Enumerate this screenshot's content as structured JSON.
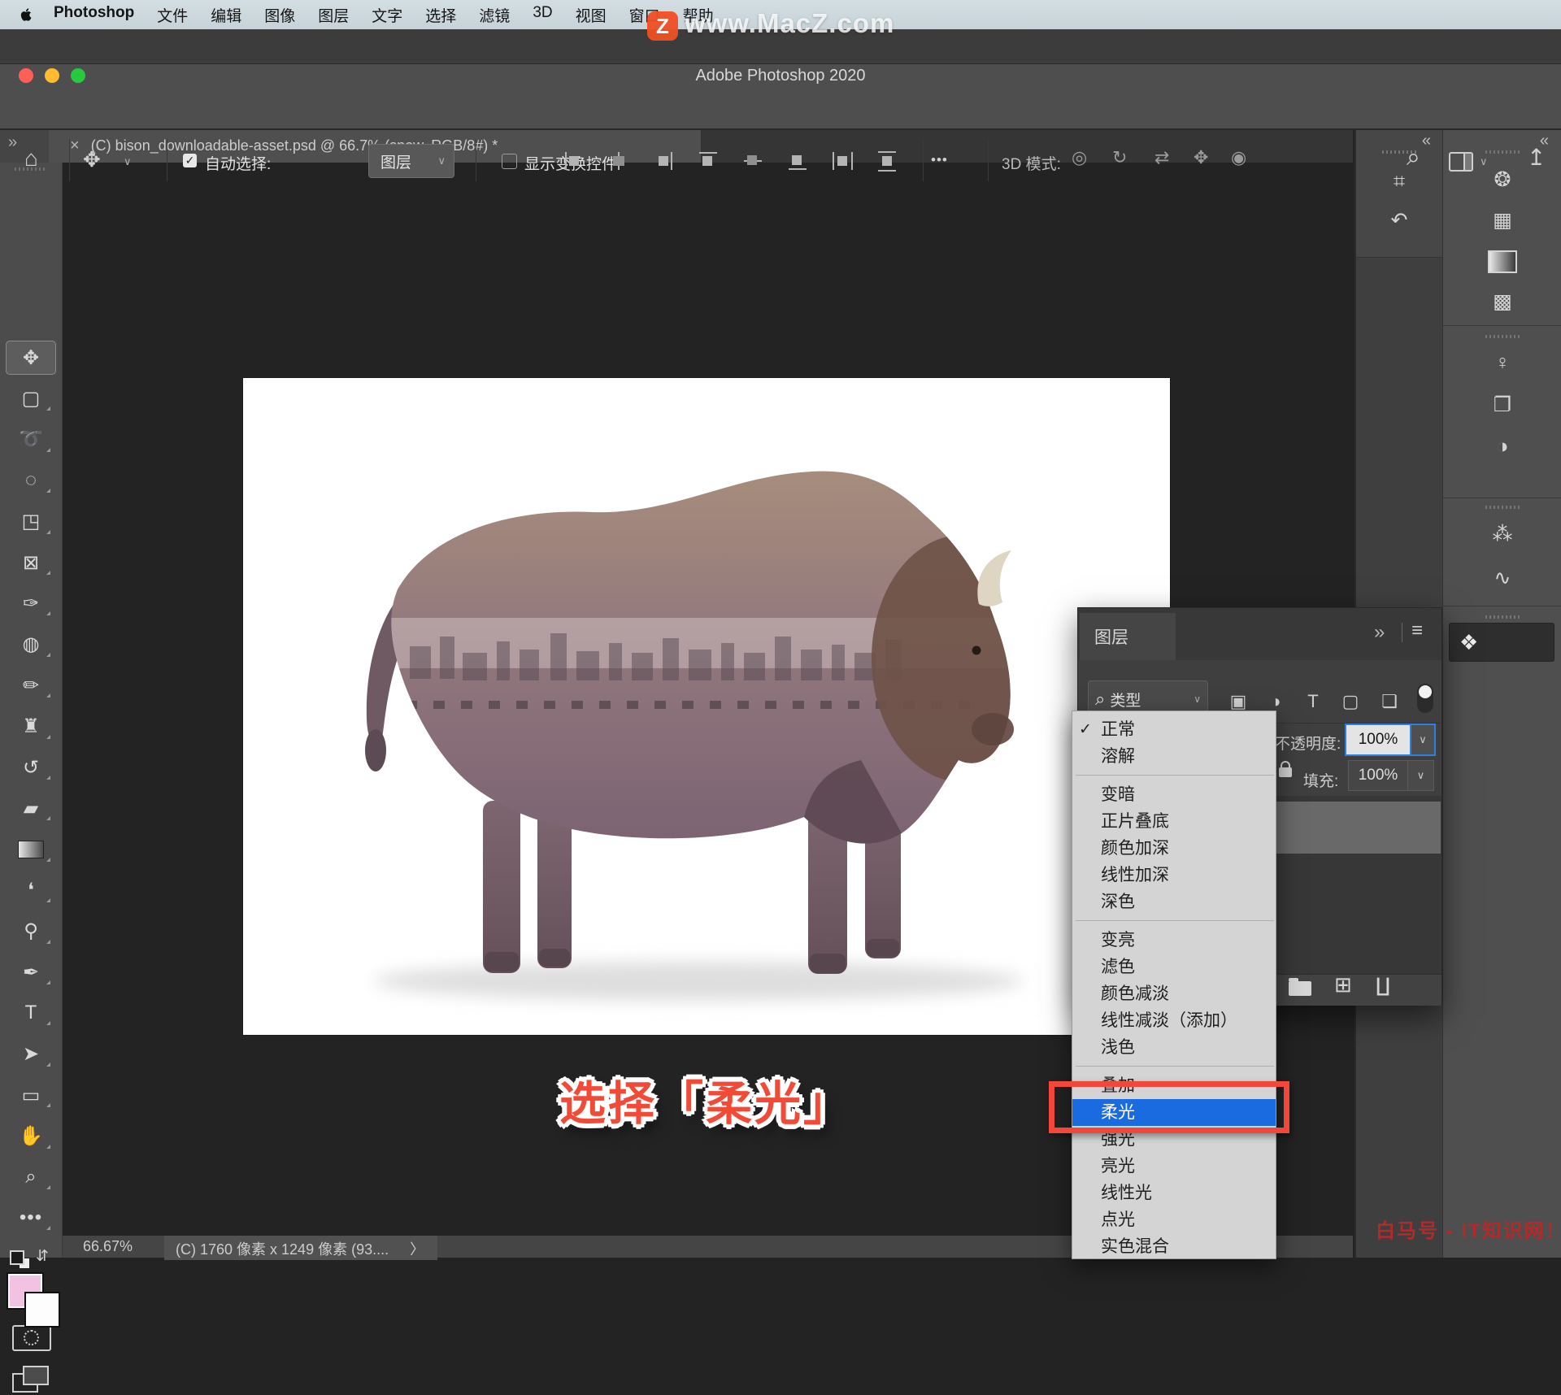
{
  "colors": {
    "accent_blue": "#1a6be0",
    "annotation_red": "#f14b38",
    "badge_orange": "#f04f23",
    "fg_swatch_pink": "#f2c2e2",
    "watermark_red": "#b22a2a"
  },
  "menubar": {
    "apple_icon": "apple-logo",
    "items": [
      "Photoshop",
      "文件",
      "编辑",
      "图像",
      "图层",
      "文字",
      "选择",
      "滤镜",
      "3D",
      "视图",
      "窗口",
      "帮助"
    ]
  },
  "titlebar": {
    "title": "Adobe Photoshop 2020"
  },
  "watermark_top": {
    "badge": "Z",
    "text": "www.MacZ.com"
  },
  "watermark_bottom": {
    "text": "白马号 - IT知识网！"
  },
  "options_bar": {
    "home_icon": "⌂",
    "move_icon": "✥",
    "chevron": "∨",
    "auto_select_label": "自动选择:",
    "target_value": "图层",
    "show_transform_label": "显示变换控件",
    "align_icons": [
      {
        "name": "align-left-icon"
      },
      {
        "name": "align-center-h-icon"
      },
      {
        "name": "align-right-icon"
      },
      {
        "name": "align-top-icon"
      },
      {
        "name": "align-middle-icon"
      },
      {
        "name": "align-bottom-icon"
      },
      {
        "name": "distribute-h-icon"
      },
      {
        "name": "distribute-v-icon"
      }
    ],
    "more_label": "•••",
    "mode_3d_label": "3D 模式:",
    "mode_3d_icons": [
      {
        "name": "3d-orbit-icon",
        "glyph": "◎"
      },
      {
        "name": "3d-roll-icon",
        "glyph": "↻"
      },
      {
        "name": "3d-pan-icon",
        "glyph": "⇄"
      },
      {
        "name": "3d-slide-icon",
        "glyph": "✥"
      },
      {
        "name": "3d-camera-icon",
        "glyph": "◉"
      }
    ],
    "search_icon": "⌕",
    "share_icon": "↥"
  },
  "tab_bar": {
    "collapse_icon": "»",
    "close_icon": "×",
    "title": "(C) bison_downloadable-asset.psd @ 66.7% (snow, RGB/8#) *"
  },
  "toolbar": {
    "tools": [
      {
        "name": "move-tool",
        "glyph": "✥",
        "selected": true
      },
      {
        "name": "marquee-tool",
        "glyph": "▢"
      },
      {
        "name": "lasso-tool",
        "glyph": "➰"
      },
      {
        "name": "object-selection-tool",
        "glyph": "◌"
      },
      {
        "name": "crop-tool",
        "glyph": "◳"
      },
      {
        "name": "frame-tool",
        "glyph": "⊠"
      },
      {
        "name": "eyedropper-tool",
        "glyph": "✑"
      },
      {
        "name": "healing-brush-tool",
        "glyph": "◍"
      },
      {
        "name": "brush-tool",
        "glyph": "✏"
      },
      {
        "name": "clone-stamp-tool",
        "glyph": "♜"
      },
      {
        "name": "history-brush-tool",
        "glyph": "↺"
      },
      {
        "name": "eraser-tool",
        "glyph": "▰"
      },
      {
        "name": "gradient-tool",
        "glyph": ""
      },
      {
        "name": "blur-tool",
        "glyph": "❛"
      },
      {
        "name": "dodge-tool",
        "glyph": "⚲"
      },
      {
        "name": "pen-tool",
        "glyph": "✒"
      },
      {
        "name": "type-tool",
        "glyph": "T"
      },
      {
        "name": "path-select-tool",
        "glyph": "➤"
      },
      {
        "name": "shape-tool",
        "glyph": "▭"
      },
      {
        "name": "hand-tool",
        "glyph": "✋"
      },
      {
        "name": "zoom-tool",
        "glyph": "⌕"
      },
      {
        "name": "toolbar-more",
        "glyph": "•••"
      }
    ]
  },
  "layers_panel": {
    "tab_label": "图层",
    "collapse_icon": "»",
    "menu_icon": "≡",
    "filter": {
      "search_icon": "⌕",
      "label": "类型",
      "chevron": "∨",
      "icons": [
        {
          "name": "filter-image-icon",
          "glyph": "▣"
        },
        {
          "name": "filter-adjustment-icon",
          "glyph": "◑"
        },
        {
          "name": "filter-type-icon",
          "glyph": "T"
        },
        {
          "name": "filter-shape-icon",
          "glyph": "▢"
        },
        {
          "name": "filter-smart-object-icon",
          "glyph": "❏"
        }
      ]
    },
    "opacity_label": "不透明度:",
    "opacity_value": "100%",
    "fill_label": "填充:",
    "fill_value": "100%",
    "bottom_icons": [
      {
        "name": "new-group-icon",
        "glyph": "folder"
      },
      {
        "name": "new-layer-icon",
        "glyph": "⊞"
      },
      {
        "name": "delete-layer-icon",
        "glyph": "∐"
      }
    ]
  },
  "blend_mode_menu": {
    "checkmark": "✓",
    "checked_item": "正常",
    "selected": "柔光",
    "groups": [
      [
        "正常",
        "溶解"
      ],
      [
        "变暗",
        "正片叠底",
        "颜色加深",
        "线性加深",
        "深色"
      ],
      [
        "变亮",
        "滤色",
        "颜色减淡",
        "线性减淡（添加）",
        "浅色"
      ],
      [
        "叠加",
        "柔光",
        "强光",
        "亮光",
        "线性光",
        "点光",
        "实色混合"
      ]
    ]
  },
  "annotation": {
    "text": "选择「柔光」"
  },
  "status_bar": {
    "zoom": "66.67%",
    "info": "(C) 1760 像素 x 1249 像素 (93....",
    "chevron": "〉"
  },
  "right_dock": {
    "collapse_icon": "«",
    "column_a": [
      {
        "name": "panel-3d-icon",
        "glyph": "⌗"
      },
      {
        "name": "panel-history-icon",
        "glyph": "↶"
      }
    ],
    "column_b": [
      {
        "name": "panel-color-icon",
        "glyph": "❂"
      },
      {
        "name": "panel-swatches-icon",
        "glyph": "▦"
      },
      {
        "name": "panel-gradients-icon",
        "glyph": "gradient"
      },
      {
        "name": "panel-patterns-icon",
        "glyph": "▩"
      },
      {
        "name": "panel-learn-icon",
        "glyph": "♀"
      },
      {
        "name": "panel-libraries-icon",
        "glyph": "❐"
      },
      {
        "name": "panel-adjustments-icon",
        "glyph": "◑"
      },
      {
        "name": "panel-color-mixer-icon",
        "glyph": "⁂"
      },
      {
        "name": "panel-paths-icon",
        "glyph": "∿"
      }
    ],
    "layers_button": {
      "name": "panel-layers-button",
      "glyph": "❖",
      "label": ""
    }
  }
}
